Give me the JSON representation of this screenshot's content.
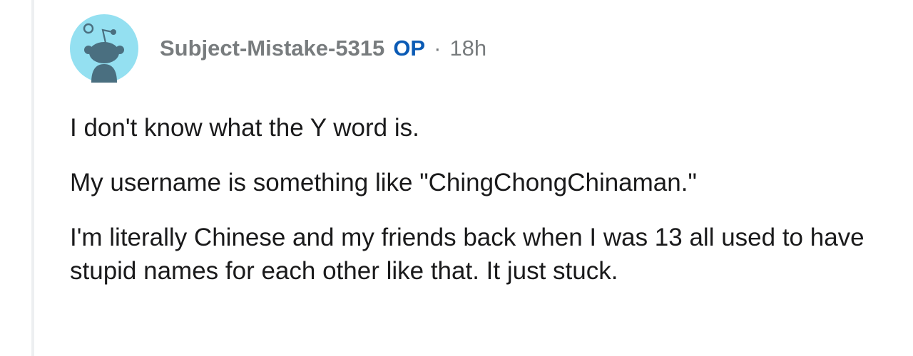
{
  "comment": {
    "author": "Subject-Mistake-5315",
    "op_badge": "OP",
    "separator": "·",
    "time": "18h",
    "avatar_icon": "snoo-avatar-icon",
    "paragraphs": [
      "I don't know what the Y word is.",
      "My username is something like \"ChingChongChinaman.\"",
      "I'm literally Chinese and my friends back when I was 13 all used to have stupid names for each other like that. It just stuck."
    ]
  },
  "colors": {
    "avatar_bg": "#94e0f1",
    "snoo": "#4a6f80",
    "author": "#787c7e",
    "op": "#0b5bb5",
    "thread_line": "#edeff1"
  }
}
